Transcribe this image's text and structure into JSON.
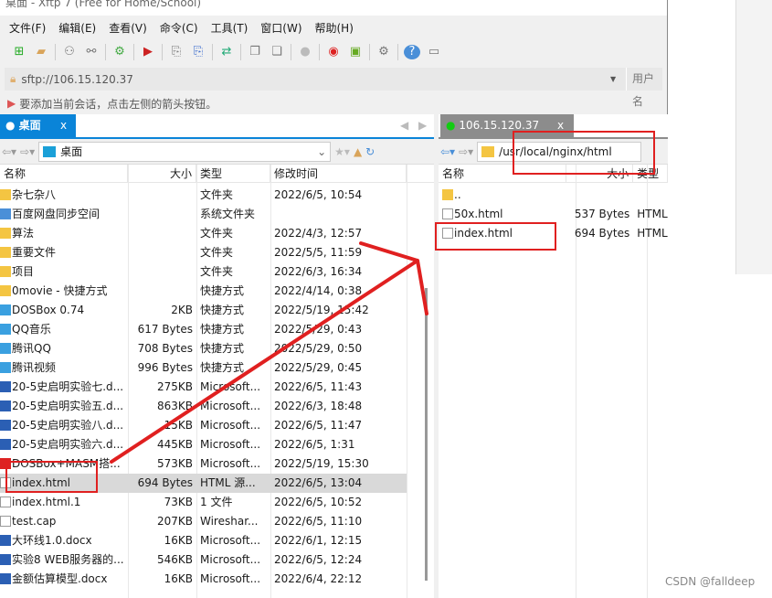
{
  "window": {
    "title": "桌面 - Xftp 7 (Free for Home/School)"
  },
  "menu": [
    "文件(F)",
    "编辑(E)",
    "查看(V)",
    "命令(C)",
    "工具(T)",
    "窗口(W)",
    "帮助(H)"
  ],
  "address": {
    "value": "sftp://106.15.120.37",
    "user_placeholder": "用户名"
  },
  "hint": "要添加当前会话，点击左侧的箭头按钮。",
  "left": {
    "tab": "桌面",
    "close": "x",
    "path": "桌面",
    "columns": [
      "名称",
      "大小",
      "类型",
      "修改时间"
    ],
    "rows": [
      [
        "杂七杂八",
        "",
        "文件夹",
        "2022/6/5, 10:54",
        "folder"
      ],
      [
        "百度网盘同步空间",
        "",
        "系统文件夹",
        "",
        "cloud"
      ],
      [
        "算法",
        "",
        "文件夹",
        "2022/4/3, 12:57",
        "folder"
      ],
      [
        "重要文件",
        "",
        "文件夹",
        "2022/5/5, 11:59",
        "folder"
      ],
      [
        "项目",
        "",
        "文件夹",
        "2022/6/3, 16:34",
        "folder"
      ],
      [
        "0movie - 快捷方式",
        "",
        "快捷方式",
        "2022/4/14, 0:38",
        "folder"
      ],
      [
        "DOSBox 0.74",
        "2KB",
        "快捷方式",
        "2022/5/19, 15:42",
        "app"
      ],
      [
        "QQ音乐",
        "617 Bytes",
        "快捷方式",
        "2022/5/29, 0:43",
        "app"
      ],
      [
        "腾讯QQ",
        "708 Bytes",
        "快捷方式",
        "2022/5/29, 0:50",
        "app"
      ],
      [
        "腾讯视频",
        "996 Bytes",
        "快捷方式",
        "2022/5/29, 0:45",
        "app"
      ],
      [
        "20-5史启明实验七.d...",
        "275KB",
        "Microsoft...",
        "2022/6/5, 11:43",
        "doc"
      ],
      [
        "20-5史启明实验五.d...",
        "863KB",
        "Microsoft...",
        "2022/6/3, 18:48",
        "doc"
      ],
      [
        "20-5史启明实验八.d...",
        "15KB",
        "Microsoft...",
        "2022/6/5, 11:47",
        "doc"
      ],
      [
        "20-5史启明实验六.d...",
        "445KB",
        "Microsoft...",
        "2022/6/5, 1:31",
        "doc"
      ],
      [
        "DOSBox+MASM搭...",
        "573KB",
        "Microsoft...",
        "2022/5/19, 15:30",
        "pdf"
      ],
      [
        "index.html",
        "694 Bytes",
        "HTML 源...",
        "2022/6/5, 13:04",
        "file"
      ],
      [
        "index.html.1",
        "73KB",
        "1 文件",
        "2022/6/5, 10:52",
        "file"
      ],
      [
        "test.cap",
        "207KB",
        "Wireshar...",
        "2022/6/5, 11:10",
        "file"
      ],
      [
        "大环线1.0.docx",
        "16KB",
        "Microsoft...",
        "2022/6/1, 12:15",
        "doc"
      ],
      [
        "实验8 WEB服务器的...",
        "546KB",
        "Microsoft...",
        "2022/6/5, 12:24",
        "doc"
      ],
      [
        "金额估算模型.docx",
        "16KB",
        "Microsoft...",
        "2022/6/4, 22:12",
        "doc"
      ]
    ],
    "selected_index": 15
  },
  "right": {
    "tab": "106.15.120.37",
    "close": "x",
    "path": "/usr/local/nginx/html",
    "columns": [
      "名称",
      "大小",
      "类型"
    ],
    "rows": [
      [
        "..",
        "",
        ""
      ],
      [
        "50x.html",
        "537 Bytes",
        "HTML"
      ],
      [
        "index.html",
        "694 Bytes",
        "HTML"
      ]
    ]
  },
  "watermark": "CSDN @falldeep",
  "colors": {
    "accent": "#0a84d8",
    "annotation": "#e02020"
  }
}
